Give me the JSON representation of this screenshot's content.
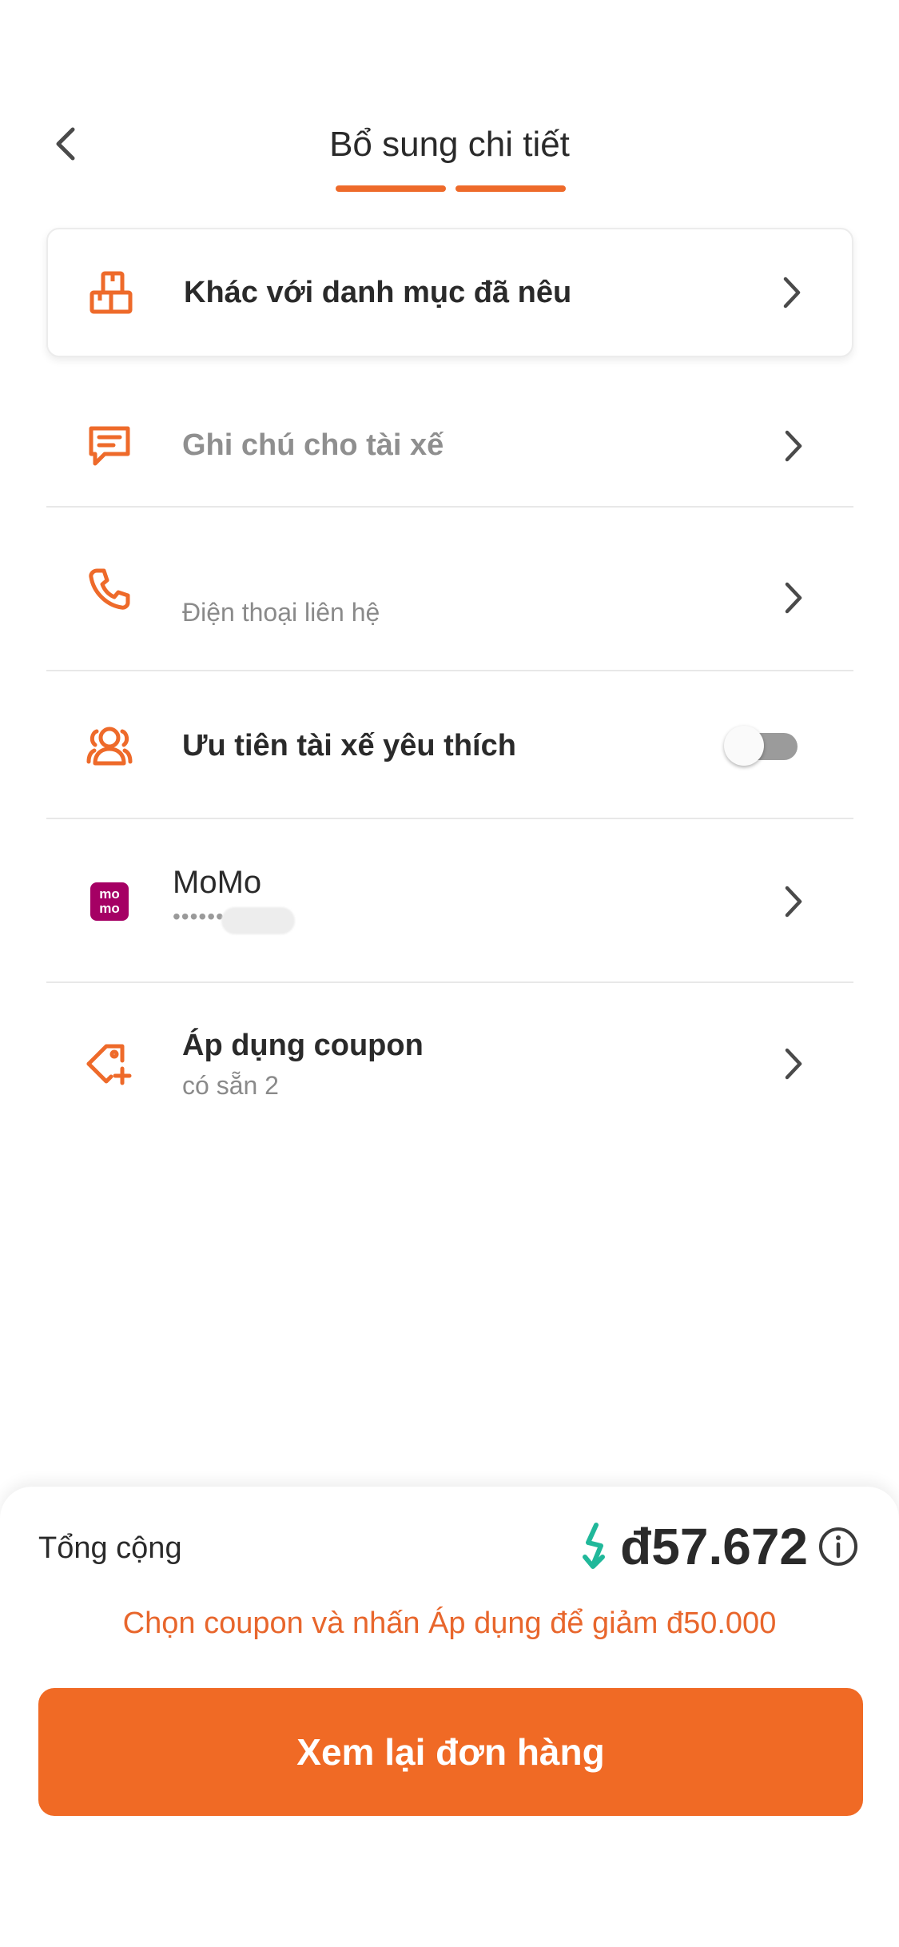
{
  "header": {
    "title": "Bổ sung chi tiết",
    "back_icon": "chevron-left-icon"
  },
  "rows": {
    "category": {
      "label": "Khác với danh mục đã nêu",
      "icon": "boxes-icon"
    },
    "driver_note": {
      "label": "Ghi chú cho tài xế",
      "icon": "message-icon"
    },
    "contact_phone": {
      "label": "Điện thoại liên hệ",
      "icon": "phone-icon"
    },
    "favorite_driver": {
      "label": "Ưu tiên tài xế yêu thích",
      "icon": "users-icon",
      "toggle_on": false
    },
    "payment": {
      "label": "MoMo",
      "masked": "••••••",
      "badge_top": "mo",
      "badge_bottom": "mo",
      "icon": "momo-icon"
    },
    "coupon": {
      "label": "Áp dụng coupon",
      "sub": "có sẵn 2",
      "icon": "tag-plus-icon"
    }
  },
  "summary": {
    "total_label": "Tổng cộng",
    "amount": "đ57.672",
    "promo_text": "Chọn coupon và nhấn Áp dụng để giảm đ50.000",
    "cta_label": "Xem lại đơn hàng"
  },
  "colors": {
    "accent": "#f06a25",
    "accent_text": "#e8662c",
    "teal": "#20b89a",
    "momo": "#a50064"
  }
}
